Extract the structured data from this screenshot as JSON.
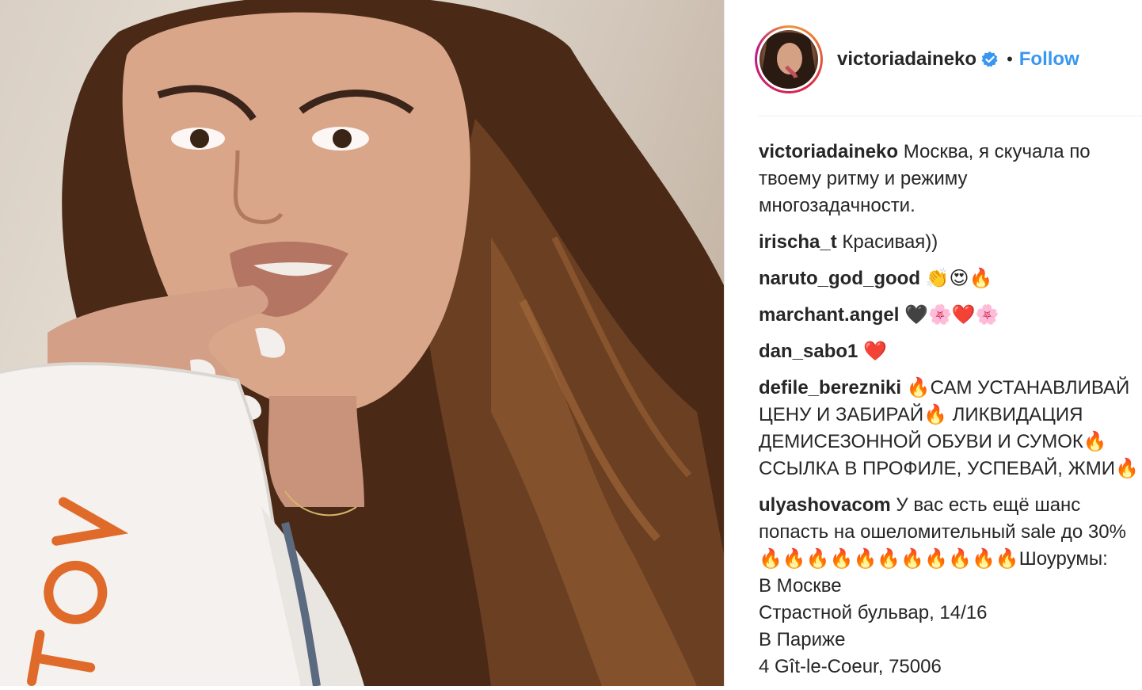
{
  "post": {
    "photo_alt": "",
    "bag_text": "TO∨"
  },
  "header": {
    "username": "victoriadaineko",
    "separator": "•",
    "follow_label": "Follow"
  },
  "comments": [
    {
      "user": "victoriadaineko",
      "text": "Москва, я скучала по\nтвоему ритму и режиму\nмногозадачности."
    },
    {
      "user": "irischa_t",
      "text": "Красивая))"
    },
    {
      "user": "naruto_god_good",
      "text": "👏😍🔥"
    },
    {
      "user": "marchant.angel",
      "text": "🖤🌸❤️🌸"
    },
    {
      "user": "dan_sabo1",
      "text": "❤️"
    },
    {
      "user": "defile_berezniki",
      "text": "🔥САМ УСТАНАВЛИВАЙ\nЦЕНУ И ЗАБИРАЙ🔥 ЛИКВИДАЦИЯ\nДЕМИСЕЗОННОЙ ОБУВИ И СУМОК🔥\nССЫЛКА В ПРОФИЛЕ, УСПЕВАЙ, ЖМИ🔥"
    },
    {
      "user": "ulyashovacom",
      "text": "У вас есть ещё шанс\nпопасть на ошеломительный sale до 30%\n🔥🔥🔥🔥🔥🔥🔥🔥🔥🔥🔥Шоурумы:\nВ Москве\nСтрастной бульвар, 14/16\nВ Париже\n4 Gît-le-Coeur, 75006"
    }
  ],
  "colors": {
    "link_blue": "#3897f0",
    "verified_blue": "#3897f0",
    "text": "#262626"
  },
  "icons": {
    "verified": "verified-badge-icon"
  }
}
